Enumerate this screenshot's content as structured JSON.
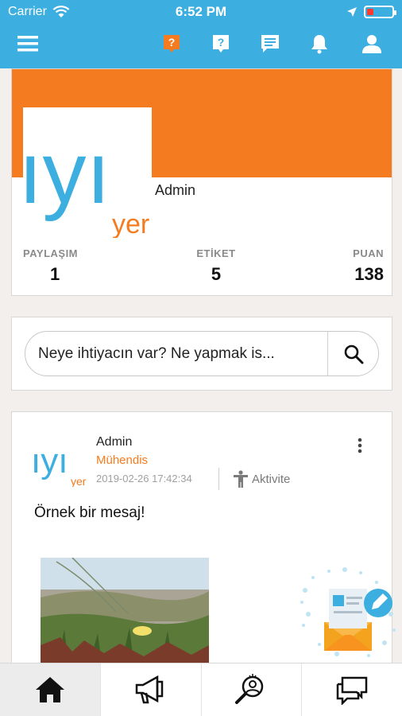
{
  "status_bar": {
    "carrier": "Carrier",
    "time": "6:52 PM"
  },
  "header": {
    "background_color": "#3daee0",
    "icons": [
      "menu-icon",
      "question-active-icon",
      "question-icon",
      "message-icon",
      "bell-icon",
      "user-icon"
    ],
    "active_icon_color": "#f47b20"
  },
  "profile": {
    "banner_color": "#f47b20",
    "logo_text_main": "ıyı",
    "logo_text_sub": "yer",
    "name": "Admin",
    "stats": [
      {
        "label": "PAYLAŞIM",
        "value": "1"
      },
      {
        "label": "ETİKET",
        "value": "5"
      },
      {
        "label": "PUAN",
        "value": "138"
      }
    ]
  },
  "search": {
    "value": "Neye ihtiyacın var? Ne yapmak is..."
  },
  "post": {
    "author": "Admin",
    "role": "Mühendis",
    "date": "2019-02-26 17:42:34",
    "activity_label": "Aktivite",
    "text": "Örnek bir mesaj!"
  },
  "bottom_nav": {
    "items": [
      "home-icon",
      "megaphone-icon",
      "search-person-icon",
      "chat-icon"
    ],
    "active_index": 0
  }
}
